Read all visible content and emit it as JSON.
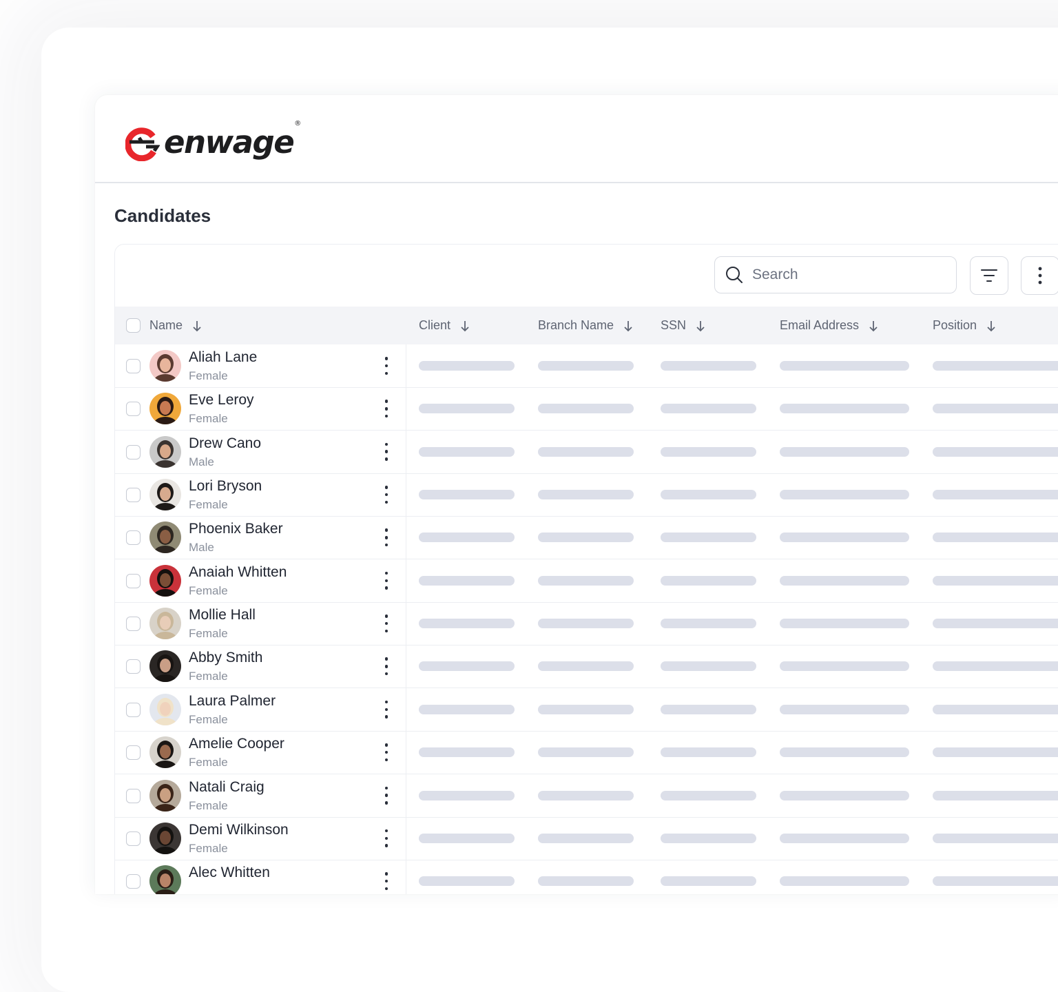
{
  "brand": {
    "name": "enwage",
    "reg_mark": "®",
    "accent": "#e8262b"
  },
  "page": {
    "title": "Candidates"
  },
  "toolbar": {
    "search_placeholder": "Search"
  },
  "table": {
    "columns": [
      "Name",
      "Client",
      "Branch Name",
      "SSN",
      "Email Address",
      "Position"
    ],
    "rows": [
      {
        "name": "Aliah Lane",
        "gender": "Female"
      },
      {
        "name": "Eve Leroy",
        "gender": "Female"
      },
      {
        "name": "Drew Cano",
        "gender": "Male"
      },
      {
        "name": "Lori Bryson",
        "gender": "Female"
      },
      {
        "name": "Phoenix Baker",
        "gender": "Male"
      },
      {
        "name": "Anaiah Whitten",
        "gender": "Female"
      },
      {
        "name": "Mollie Hall",
        "gender": "Female"
      },
      {
        "name": "Abby Smith",
        "gender": "Female"
      },
      {
        "name": "Laura Palmer",
        "gender": "Female"
      },
      {
        "name": "Amelie Cooper",
        "gender": "Female"
      },
      {
        "name": "Natali Craig",
        "gender": "Female"
      },
      {
        "name": "Demi Wilkinson",
        "gender": "Female"
      },
      {
        "name": "Alec Whitten",
        "gender": ""
      }
    ]
  }
}
